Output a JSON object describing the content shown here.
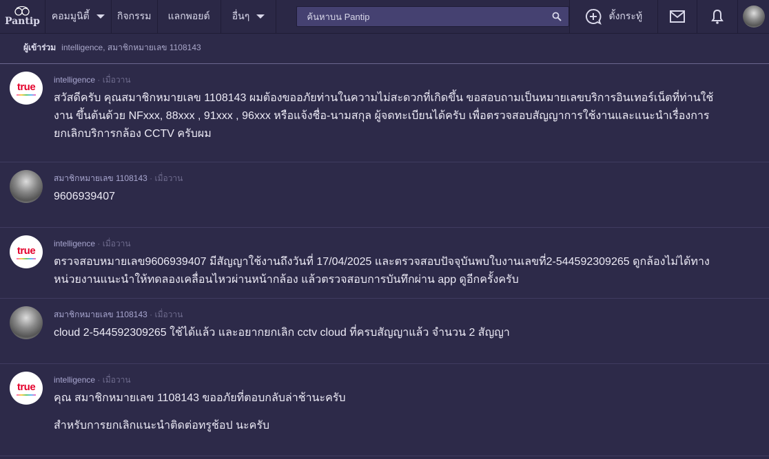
{
  "nav": {
    "logo": "Pantip",
    "community": "คอมมูนิตี้",
    "activities": "กิจกรรม",
    "points": "แลกพอยต์",
    "more": "อื่นๆ",
    "search_placeholder": "ค้นหาบน Pantip",
    "post": "ตั้งกระทู้"
  },
  "participants": {
    "label": "ผู้เข้าร่วม",
    "names": "intelligence, สมาชิกหมายเลข 1108143"
  },
  "comments": [
    {
      "user": "intelligence",
      "time": "· เมื่อวาน",
      "avatar": "true",
      "paragraphs": [
        "สวัสดีครับ คุณสมาชิกหมายเลข 1108143 ผมต้องขออภัยท่านในความไม่สะดวกที่เกิดขึ้น ขอสอบถามเป็นหมายเลขบริการอินเทอร์เน็ตที่ท่านใช้งาน ขึ้นต้นด้วย NFxxx, 88xxx , 91xxx , 96xxx หรือแจ้งชื่อ-นามสกุล ผู้จดทะเบียนได้ครับ เพื่อตรวจสอบสัญญาการใช้งานและแนะนำเรื่องการยกเลิกบริการกล้อง CCTV ครับผม"
      ]
    },
    {
      "user": "สมาชิกหมายเลข 1108143",
      "time": "· เมื่อวาน",
      "paragraphs": [
        "9606939407"
      ]
    },
    {
      "user": "intelligence",
      "time": "· เมื่อวาน",
      "avatar": "true",
      "paragraphs": [
        "ตรวจสอบหมายเลข9606939407 มีสัญญาใช้งานถึงวันที่ 17/04/2025 และตรวจสอบปัจจุบันพบใบงานเลขที่2-544592309265 ดูกล้องไม่ได้ทางหน่วยงานแนะนำให้ทดลองเคลื่อนไหวผ่านหน้ากล้อง แล้วตรวจสอบการบันทึกผ่าน app ดูอีกครั้งครับ"
      ]
    },
    {
      "user": "สมาชิกหมายเลข 1108143",
      "time": "· เมื่อวาน",
      "paragraphs": [
        "cloud 2-544592309265 ใช้ได้แล้ว และอยากยกเลิก cctv cloud ที่ครบสัญญาแล้ว จำนวน 2 สัญญา"
      ]
    },
    {
      "user": "intelligence",
      "time": "· เมื่อวาน",
      "avatar": "true",
      "paragraphs": [
        "คุณ สมาชิกหมายเลข 1108143 ขออภัยที่ตอบกลับล่าช้านะครับ",
        "สำหรับการยกเลิกแนะนำติดต่อทรูช้อป นะครับ"
      ]
    }
  ]
}
